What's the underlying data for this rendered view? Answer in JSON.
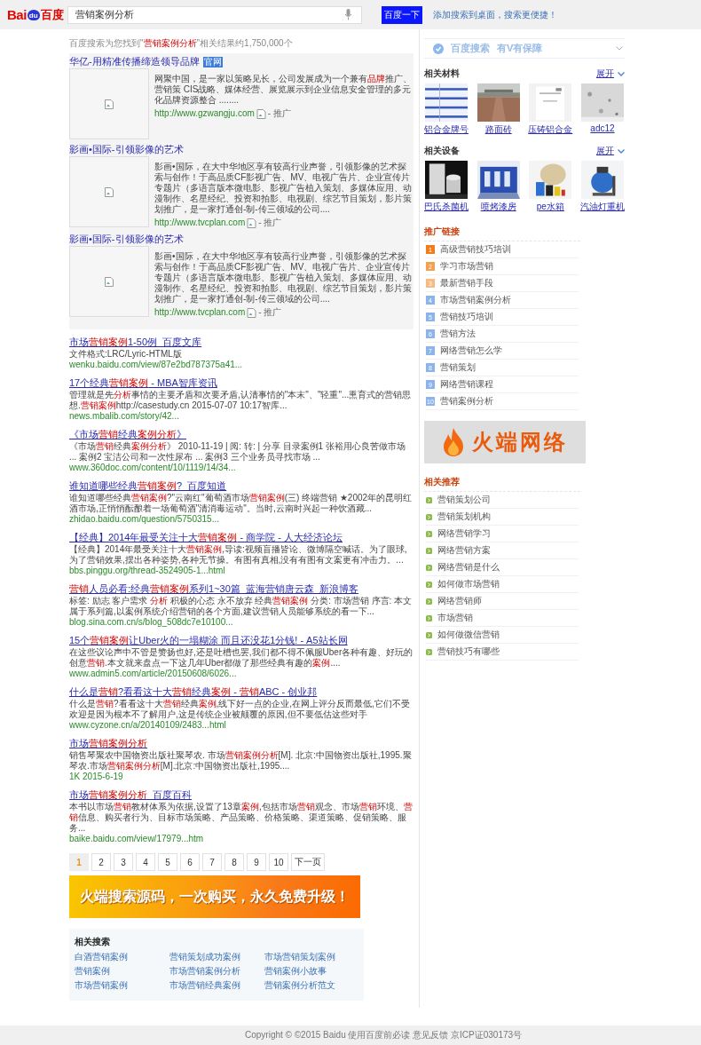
{
  "header": {
    "logo": {
      "left": "Bai",
      "paw": "du",
      "right": "百度"
    },
    "search": {
      "value": "营销案例分析"
    },
    "search_button": "百度一下",
    "desktop_link": "添加搜索到桌面，搜索更便捷！"
  },
  "result_stats": "百度搜索为您找到\"**营销案例分析**\"相关结果约1,750,000个",
  "ads": [
    {
      "title": "华亿-用精准传播缔造领导品牌",
      "badge": "官网",
      "description": "网聚中国，是一家以策略见长，公司发展成为一个兼有**品牌**推广、营销策 CIS战略、媒体经营、展览展示到企业信息安全管理的多元化品牌资源整合 ........",
      "url": "http://www.gzwangju.com",
      "tag": "- 推广"
    },
    {
      "title": "影画•国际-引领影像的艺术",
      "description": "影画•国际，在大中华地区享有较高行业声誉，引领影像的艺术探索与创作！于高品质CF影视广告、MV、电视广告片、企业宣传片专题片（多语言版本微电影、影视广告植入策划、多媒体应用、动漫制作、名星经纪、投资和拍影、电视剧、综艺节目策划，影片策划推广，是一家打通创-制-传三领域的公司....",
      "url": "http://www.tvcplan.com",
      "tag": "- 推广"
    },
    {
      "title": "影画•国际-引领影像的艺术",
      "description": "影画•国际，在大中华地区享有较高行业声誉，引领影像的艺术探索与创作！于高品质CF影视广告、MV、电视广告片、企业宣传片专题片（多语言版本微电影、影视广告植入策划、多媒体应用、动漫制作、名星经纪、投资和拍影、电视剧、综艺节目策划，影片策划推广，是一家打通创-制-传三领域的公司....",
      "url": "http://www.tvcplan.com",
      "tag": "- 推广"
    }
  ],
  "results": [
    {
      "title": "市场**营销案例**1-50例_百度文库",
      "description": "文件格式:LRC/Lyric-HTML版",
      "url": "wenku.baidu.com/view/87e2bd787375a41..."
    },
    {
      "title": "17个经典**营销案例** - MBA智库资讯",
      "description": "管理就是先**分析**事情的主要矛盾和次要矛盾,认清事情的\"本末\"、\"轻重\"...熏育式的营销思想.**营销案例**http://casestudy.cn 2015-07-07 10:17智库...",
      "url": "news.mbalib.com/story/42..."
    },
    {
      "title": "《市场**营销**经典**案例分析**》",
      "description": "《市场**营销**经典**案例分析**》 2010-11-19 | 阅: 转: | 分享 目录案例1 张裕用心良苦做市场 ... 案例2 宝洁公司和一次性尿布 ... 案例3 三个业务员寻找市场 ...",
      "url": "www.360doc.com/content/10/1119/14/34..."
    },
    {
      "title": "谁知道哪些经典**营销案例**?_百度知道",
      "description": "谁知道哪些经典**营销案例**?\"云南红\"葡萄酒市场**营销案例**(三) 终端营销 ★2002年的昆明红酒市场,正悄悄酝酿着一场葡萄酒\"清消毒运动\"。当时,云南时兴起一种饮酒藏...",
      "url": "zhidao.baidu.com/question/5750315..."
    },
    {
      "title": "【经典】2014年最受关注十大**营销案例** - 商学院 - 人大经济论坛",
      "description": "【经典】2014年最受关注十大**营销案例**,导读:视频盲播皆论、微博隔空喊话。为了眼球,为了营销效果,摆出各种姿势,各种无节操。有图有真相,没有有图有文案更有冲击力。...",
      "url": "bbs.pinggu.org/thread-3524905-1...html"
    },
    {
      "title": "**营销**人员必看:经典**营销案例**系列1~30篇_蓝海营销唐云森_新浪博客",
      "description": "标签: 励志 客户需求 **分析** 积极的心态 永不放弃 经典**营销案例** 分类: 市场营销 序言: 本文属于系列篇,以案例系统介绍营销的各个方面,建议营销人员能够系统的看一下...",
      "url": "blog.sina.com.cn/s/blog_508dc7e10100..."
    },
    {
      "title": "15个**营销案例**让Uber火的一塌糊涂 而且还没花1分钱! - A5站长网",
      "description": "在这些议论声中不管是赞扬也好,还是吐槽也罢,我们都不得不佩服Uber各种有趣、好玩的创意**营销**.本文就来盘点一下这几年Uber都做了那些经典有趣的**案例**....",
      "url": "www.admin5.com/article/20150608/6026..."
    },
    {
      "title": "什么是**营销**?看看这十大**营销**经典**案例** - **营销**ABC - 创业邦",
      "description": "什么是**营销**?看看这十大**营销**经典**案例**,线下好一点的企业,在网上评分反而最低,它们不受欢迎是因为根本不了解用户,这是传统企业被颠覆的原因,但不要低估这些对手",
      "url": "www.cyzone.cn/a/20140109/2483...html"
    },
    {
      "title": "市场**营销案例分析**",
      "description": "销售琴聚农中国物资出版社聚琴农. 市场**营销案例分析**[M]. 北京:中国物资出版社,1995.聚琴农.市场**营销案例分析**[M].北京:中国物资出版社,1995....",
      "url": "1K 2015-6-19"
    },
    {
      "title": "市场**营销案例分析**_百度百科",
      "description": "本书以市场**营销**教材体系为依据,设置了13章**案例**,包括市场**营销**观念、市场**营销**环境、**营销**信息、购买者行为、目标市场策略、产品策略、价格策略、渠道策略、促销策略、服务...",
      "url": "baike.baidu.com/view/17979...htm"
    }
  ],
  "pagination": {
    "pages": [
      {
        "label": "1",
        "selected": true
      },
      {
        "label": "2",
        "selected": false
      },
      {
        "label": "3",
        "selected": false
      },
      {
        "label": "4",
        "selected": false
      },
      {
        "label": "5",
        "selected": false
      },
      {
        "label": "6",
        "selected": false
      },
      {
        "label": "7",
        "selected": false
      },
      {
        "label": "8",
        "selected": false
      },
      {
        "label": "9",
        "selected": false
      },
      {
        "label": "10",
        "selected": false
      }
    ],
    "next": "下一页"
  },
  "banner": {
    "text": "火端搜索源码，一次购买，永久免费升级！"
  },
  "related_searches": {
    "title": "相关搜索",
    "items": [
      "白酒营销案例",
      "营销策划成功案例",
      "市场营销策划案例",
      "营销案例",
      "市场营销案例分析",
      "营销案例小故事",
      "市场营销案例",
      "市场营销经典案例",
      "营销案例分析范文"
    ]
  },
  "sidebar": {
    "guarantee": {
      "left": "百度搜索",
      "right": "有V有保障"
    },
    "materials": {
      "title": "相关材料",
      "expand": "展开",
      "items": [
        "铝合金牌号",
        "路面砖",
        "压铸铝合金",
        "adc12"
      ]
    },
    "equipment": {
      "title": "相关设备",
      "expand": "展开",
      "items": [
        "巴氏杀菌机",
        "喷烤漆房",
        "pe水箱",
        "汽油灯重机"
      ]
    },
    "promo_links": {
      "title": "推广链接",
      "items": [
        {
          "number": "1",
          "label": "高级营销技巧培训",
          "color": "#f07d1a"
        },
        {
          "number": "2",
          "label": "学习市场营销",
          "color": "#f4a04e"
        },
        {
          "number": "3",
          "label": "最新营销手段",
          "color": "#f6bb85"
        },
        {
          "number": "4",
          "label": "市场营销案例分析",
          "color": "#8db4ea"
        },
        {
          "number": "5",
          "label": "营销技巧培训",
          "color": "#8db4ea"
        },
        {
          "number": "6",
          "label": "营销方法",
          "color": "#8db4ea"
        },
        {
          "number": "7",
          "label": "网络营销怎么学",
          "color": "#8db4ea"
        },
        {
          "number": "8",
          "label": "营销策划",
          "color": "#8db4ea"
        },
        {
          "number": "9",
          "label": "网络营销课程",
          "color": "#8db4ea"
        },
        {
          "number": "10",
          "label": "营销案例分析",
          "color": "#8db4ea"
        }
      ]
    },
    "ad_logo": {
      "text": "火端网络"
    },
    "recommendations": {
      "title": "相关推荐",
      "items": [
        "营销策划公司",
        "营销策划机构",
        "网络营销学习",
        "网络营销方案",
        "网络营销是什么",
        "如何做市场营销",
        "网络营销师",
        "市场营销",
        "如何做微信营销",
        "营销技巧有哪些"
      ]
    }
  },
  "footer": {
    "copyright": "Copyright © ©2015 Baidu 使用百度前必读 意见反馈 京ICP证030173号"
  }
}
